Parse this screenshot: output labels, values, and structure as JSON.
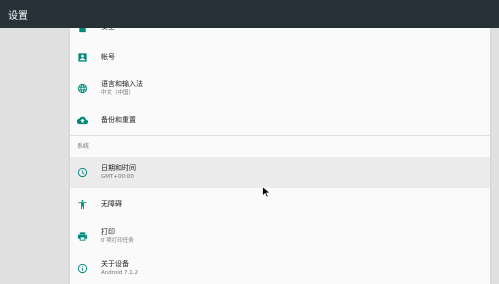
{
  "appbar": {
    "title": "设置"
  },
  "settings": {
    "top_partial": {
      "label": "安全",
      "icon": "lock-icon"
    },
    "account": {
      "label": "帐号",
      "icon": "account-box-icon"
    },
    "language": {
      "label": "语言和输入法",
      "sub": "中文（中国）",
      "icon": "globe-icon"
    },
    "backup": {
      "label": "备份和重置",
      "icon": "cloud-upload-icon"
    },
    "system_section": "系统",
    "datetime": {
      "label": "日期和时间",
      "sub": "GMT+00:00",
      "icon": "clock-icon"
    },
    "accessibility": {
      "label": "无障碍",
      "icon": "accessibility-icon"
    },
    "printing": {
      "label": "打印",
      "sub": "0 项打印任务",
      "icon": "printer-icon"
    },
    "about": {
      "label": "关于设备",
      "sub": "Android 7.1.2",
      "icon": "info-icon"
    }
  },
  "colors": {
    "appbar": "#263238",
    "accent": "#00897b",
    "background": "#e0e0e0",
    "panel": "#fafafa"
  }
}
